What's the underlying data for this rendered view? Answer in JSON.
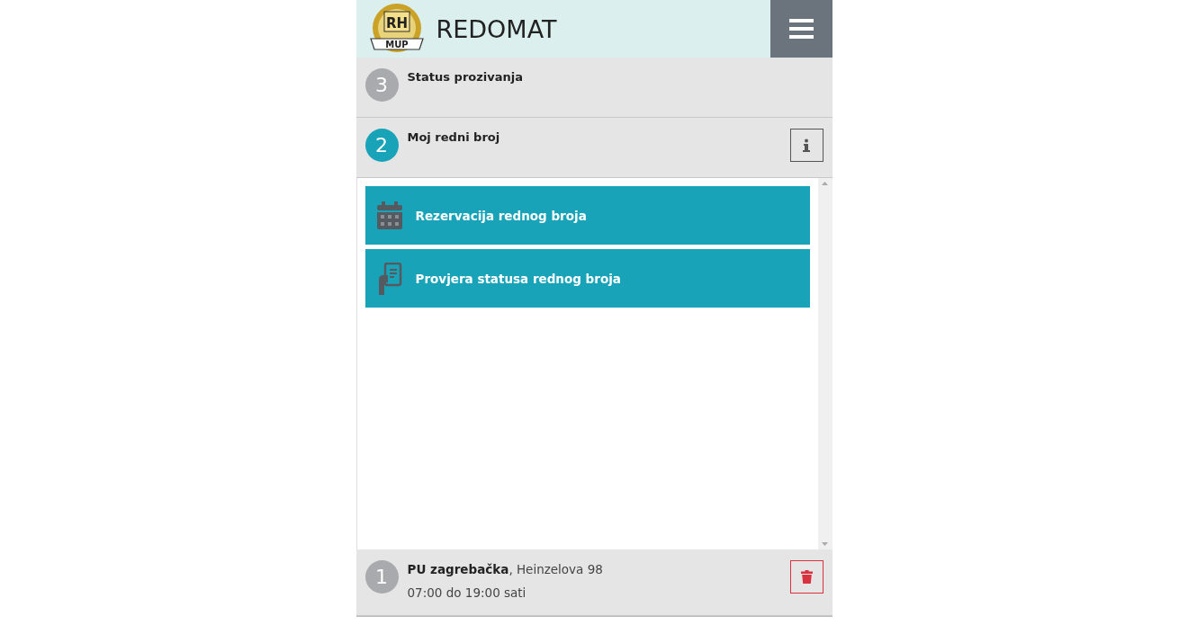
{
  "header": {
    "logo": {
      "top": "RH",
      "bottom": "MUP"
    },
    "title": "REDOMAT"
  },
  "steps": [
    {
      "number": "3",
      "title": "Status prozivanja",
      "active": false,
      "kind": "plain"
    },
    {
      "number": "2",
      "title": "Moj redni broj",
      "active": true,
      "kind": "info"
    }
  ],
  "menu": [
    {
      "label": "Rezervacija rednog broja",
      "kind": "calendar"
    },
    {
      "label": "Provjera statusa rednog broja",
      "kind": "phone"
    }
  ],
  "location": {
    "number": "1",
    "title": "**PU zagrebačka**, Heinzelova 98",
    "hours": "07:00 do 19:00 sati",
    "active": false,
    "kind": "delete"
  }
}
